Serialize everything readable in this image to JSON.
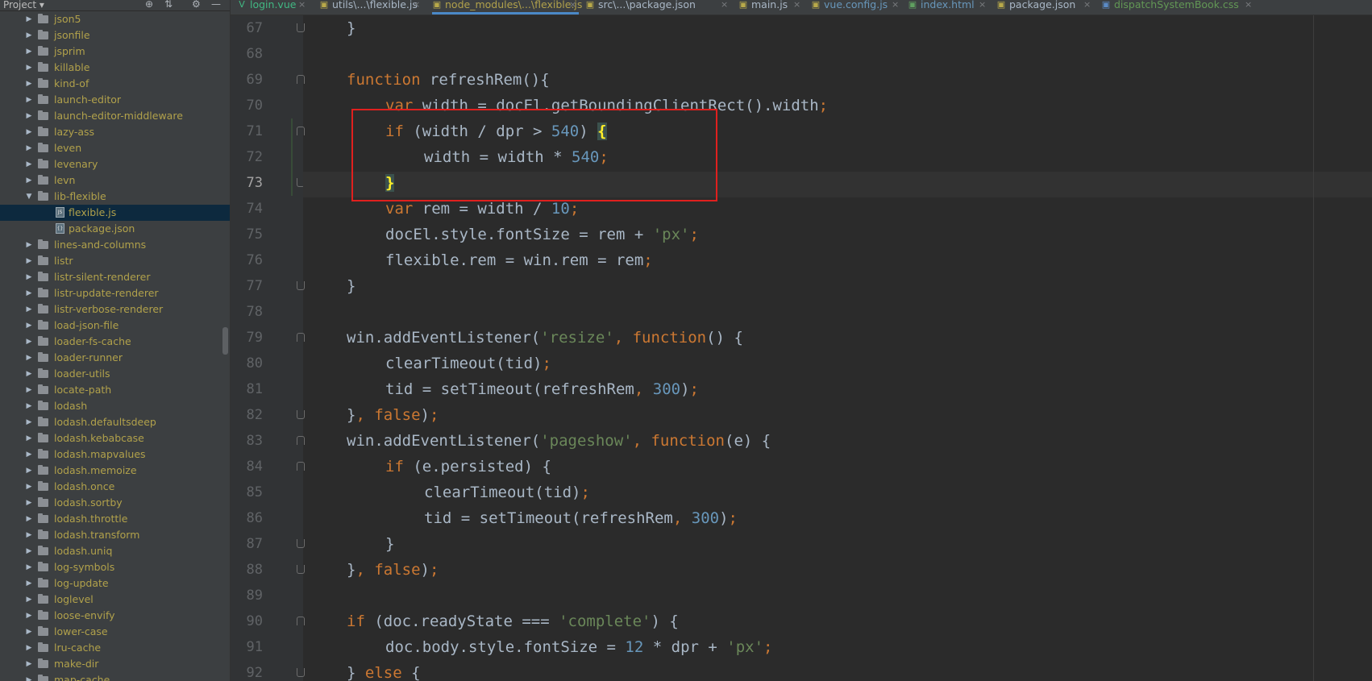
{
  "sidebar": {
    "title": "Project",
    "items": [
      {
        "label": "json5",
        "type": "folder",
        "expanded": false,
        "depth": 0
      },
      {
        "label": "jsonfile",
        "type": "folder",
        "expanded": false,
        "depth": 0
      },
      {
        "label": "jsprim",
        "type": "folder",
        "expanded": false,
        "depth": 0
      },
      {
        "label": "killable",
        "type": "folder",
        "expanded": false,
        "depth": 0
      },
      {
        "label": "kind-of",
        "type": "folder",
        "expanded": false,
        "depth": 0
      },
      {
        "label": "launch-editor",
        "type": "folder",
        "expanded": false,
        "depth": 0
      },
      {
        "label": "launch-editor-middleware",
        "type": "folder",
        "expanded": false,
        "depth": 0
      },
      {
        "label": "lazy-ass",
        "type": "folder",
        "expanded": false,
        "depth": 0
      },
      {
        "label": "leven",
        "type": "folder",
        "expanded": false,
        "depth": 0
      },
      {
        "label": "levenary",
        "type": "folder",
        "expanded": false,
        "depth": 0
      },
      {
        "label": "levn",
        "type": "folder",
        "expanded": false,
        "depth": 0
      },
      {
        "label": "lib-flexible",
        "type": "folder",
        "expanded": true,
        "depth": 0
      },
      {
        "label": "flexible.js",
        "type": "file",
        "icon": "js",
        "depth": 1,
        "selected": true
      },
      {
        "label": "package.json",
        "type": "file",
        "icon": "json",
        "depth": 1
      },
      {
        "label": "lines-and-columns",
        "type": "folder",
        "expanded": false,
        "depth": 0
      },
      {
        "label": "listr",
        "type": "folder",
        "expanded": false,
        "depth": 0
      },
      {
        "label": "listr-silent-renderer",
        "type": "folder",
        "expanded": false,
        "depth": 0
      },
      {
        "label": "listr-update-renderer",
        "type": "folder",
        "expanded": false,
        "depth": 0
      },
      {
        "label": "listr-verbose-renderer",
        "type": "folder",
        "expanded": false,
        "depth": 0
      },
      {
        "label": "load-json-file",
        "type": "folder",
        "expanded": false,
        "depth": 0
      },
      {
        "label": "loader-fs-cache",
        "type": "folder",
        "expanded": false,
        "depth": 0
      },
      {
        "label": "loader-runner",
        "type": "folder",
        "expanded": false,
        "depth": 0
      },
      {
        "label": "loader-utils",
        "type": "folder",
        "expanded": false,
        "depth": 0
      },
      {
        "label": "locate-path",
        "type": "folder",
        "expanded": false,
        "depth": 0
      },
      {
        "label": "lodash",
        "type": "folder",
        "expanded": false,
        "depth": 0
      },
      {
        "label": "lodash.defaultsdeep",
        "type": "folder",
        "expanded": false,
        "depth": 0
      },
      {
        "label": "lodash.kebabcase",
        "type": "folder",
        "expanded": false,
        "depth": 0
      },
      {
        "label": "lodash.mapvalues",
        "type": "folder",
        "expanded": false,
        "depth": 0
      },
      {
        "label": "lodash.memoize",
        "type": "folder",
        "expanded": false,
        "depth": 0
      },
      {
        "label": "lodash.once",
        "type": "folder",
        "expanded": false,
        "depth": 0
      },
      {
        "label": "lodash.sortby",
        "type": "folder",
        "expanded": false,
        "depth": 0
      },
      {
        "label": "lodash.throttle",
        "type": "folder",
        "expanded": false,
        "depth": 0
      },
      {
        "label": "lodash.transform",
        "type": "folder",
        "expanded": false,
        "depth": 0
      },
      {
        "label": "lodash.uniq",
        "type": "folder",
        "expanded": false,
        "depth": 0
      },
      {
        "label": "log-symbols",
        "type": "folder",
        "expanded": false,
        "depth": 0
      },
      {
        "label": "log-update",
        "type": "folder",
        "expanded": false,
        "depth": 0
      },
      {
        "label": "loglevel",
        "type": "folder",
        "expanded": false,
        "depth": 0
      },
      {
        "label": "loose-envify",
        "type": "folder",
        "expanded": false,
        "depth": 0
      },
      {
        "label": "lower-case",
        "type": "folder",
        "expanded": false,
        "depth": 0
      },
      {
        "label": "lru-cache",
        "type": "folder",
        "expanded": false,
        "depth": 0
      },
      {
        "label": "make-dir",
        "type": "folder",
        "expanded": false,
        "depth": 0
      },
      {
        "label": "map-cache",
        "type": "folder",
        "expanded": false,
        "depth": 0
      }
    ]
  },
  "tabs": [
    {
      "label": "login.vue",
      "icon": "vue-icon",
      "color": "#41b883"
    },
    {
      "label": "utils\\...\\flexible.js",
      "icon": "js-file-icon",
      "color": "#a9b7c6"
    },
    {
      "label": "node_modules\\...\\flexible.js",
      "icon": "js-file-icon",
      "color": "#b1a14b",
      "active": true
    },
    {
      "label": "src\\...\\package.json",
      "icon": "json-file-icon",
      "color": "#a9b7c6"
    },
    {
      "label": "main.js",
      "icon": "js-file-icon",
      "color": "#a9b7c6"
    },
    {
      "label": "vue.config.js",
      "icon": "js-file-icon",
      "color": "#6897bb"
    },
    {
      "label": "index.html",
      "icon": "html-file-icon",
      "color": "#6897bb"
    },
    {
      "label": "package.json",
      "icon": "json-file-icon",
      "color": "#a9b7c6"
    },
    {
      "label": "dispatchSystemBook.css",
      "icon": "css-file-icon",
      "color": "#629755"
    }
  ],
  "editor": {
    "current_line": 73,
    "lines": [
      {
        "n": "67",
        "indent": 1,
        "tokens": [
          [
            "p",
            "}"
          ]
        ]
      },
      {
        "n": "68",
        "indent": 0,
        "tokens": []
      },
      {
        "n": "69",
        "indent": 1,
        "tokens": [
          [
            "kw",
            "function "
          ],
          [
            "p",
            "refreshRem(){"
          ]
        ]
      },
      {
        "n": "70",
        "indent": 2,
        "tokens": [
          [
            "kw",
            "var "
          ],
          [
            "p",
            "width = docEl.getBoundingClientRect().width"
          ],
          [
            "kw",
            ";"
          ]
        ]
      },
      {
        "n": "71",
        "indent": 2,
        "tokens": [
          [
            "kw",
            "if "
          ],
          [
            "p",
            "(width / dpr > "
          ],
          [
            "num",
            "540"
          ],
          [
            "p",
            ") "
          ],
          [
            "bh",
            "{"
          ]
        ]
      },
      {
        "n": "72",
        "indent": 3,
        "tokens": [
          [
            "p",
            "width = width * "
          ],
          [
            "num",
            "540"
          ],
          [
            "kw",
            ";"
          ]
        ]
      },
      {
        "n": "73",
        "indent": 2,
        "tokens": [
          [
            "bh",
            "}"
          ]
        ]
      },
      {
        "n": "74",
        "indent": 2,
        "tokens": [
          [
            "kw",
            "var "
          ],
          [
            "p",
            "rem = width / "
          ],
          [
            "num",
            "10"
          ],
          [
            "kw",
            ";"
          ]
        ]
      },
      {
        "n": "75",
        "indent": 2,
        "tokens": [
          [
            "p",
            "docEl.style.fontSize = rem + "
          ],
          [
            "str",
            "'px'"
          ],
          [
            "kw",
            ";"
          ]
        ]
      },
      {
        "n": "76",
        "indent": 2,
        "tokens": [
          [
            "p",
            "flexible.rem = win.rem = rem"
          ],
          [
            "kw",
            ";"
          ]
        ]
      },
      {
        "n": "77",
        "indent": 1,
        "tokens": [
          [
            "p",
            "}"
          ]
        ]
      },
      {
        "n": "78",
        "indent": 0,
        "tokens": []
      },
      {
        "n": "79",
        "indent": 1,
        "tokens": [
          [
            "p",
            "win.addEventListener("
          ],
          [
            "str",
            "'resize'"
          ],
          [
            "kw",
            ", function"
          ],
          [
            "p",
            "() {"
          ]
        ]
      },
      {
        "n": "80",
        "indent": 2,
        "tokens": [
          [
            "p",
            "clearTimeout(tid)"
          ],
          [
            "kw",
            ";"
          ]
        ]
      },
      {
        "n": "81",
        "indent": 2,
        "tokens": [
          [
            "p",
            "tid = setTimeout(refreshRem"
          ],
          [
            "kw",
            ", "
          ],
          [
            "num",
            "300"
          ],
          [
            "p",
            ")"
          ],
          [
            "kw",
            ";"
          ]
        ]
      },
      {
        "n": "82",
        "indent": 1,
        "tokens": [
          [
            "p",
            "}"
          ],
          [
            "kw",
            ", false"
          ],
          [
            "p",
            ")"
          ],
          [
            "kw",
            ";"
          ]
        ]
      },
      {
        "n": "83",
        "indent": 1,
        "tokens": [
          [
            "p",
            "win.addEventListener("
          ],
          [
            "str",
            "'pageshow'"
          ],
          [
            "kw",
            ", function"
          ],
          [
            "p",
            "(e) {"
          ]
        ]
      },
      {
        "n": "84",
        "indent": 2,
        "tokens": [
          [
            "kw",
            "if "
          ],
          [
            "p",
            "(e.persisted) {"
          ]
        ]
      },
      {
        "n": "85",
        "indent": 3,
        "tokens": [
          [
            "p",
            "clearTimeout(tid)"
          ],
          [
            "kw",
            ";"
          ]
        ]
      },
      {
        "n": "86",
        "indent": 3,
        "tokens": [
          [
            "p",
            "tid = setTimeout(refreshRem"
          ],
          [
            "kw",
            ", "
          ],
          [
            "num",
            "300"
          ],
          [
            "p",
            ")"
          ],
          [
            "kw",
            ";"
          ]
        ]
      },
      {
        "n": "87",
        "indent": 2,
        "tokens": [
          [
            "p",
            "}"
          ]
        ]
      },
      {
        "n": "88",
        "indent": 1,
        "tokens": [
          [
            "p",
            "}"
          ],
          [
            "kw",
            ", false"
          ],
          [
            "p",
            ")"
          ],
          [
            "kw",
            ";"
          ]
        ]
      },
      {
        "n": "89",
        "indent": 0,
        "tokens": []
      },
      {
        "n": "90",
        "indent": 1,
        "tokens": [
          [
            "kw",
            "if "
          ],
          [
            "p",
            "(doc.readyState === "
          ],
          [
            "str",
            "'complete'"
          ],
          [
            "p",
            ") {"
          ]
        ]
      },
      {
        "n": "91",
        "indent": 2,
        "tokens": [
          [
            "p",
            "doc.body.style.fontSize = "
          ],
          [
            "num",
            "12"
          ],
          [
            "p",
            " * dpr + "
          ],
          [
            "str",
            "'px'"
          ],
          [
            "kw",
            ";"
          ]
        ]
      },
      {
        "n": "92",
        "indent": 1,
        "tokens": [
          [
            "p",
            "} "
          ],
          [
            "kw",
            "else "
          ],
          [
            "p",
            "{"
          ]
        ]
      }
    ]
  },
  "colors": {
    "keyword": "#cc7832",
    "string": "#6a8759",
    "number": "#6897bb",
    "plain": "#a9b7c6",
    "folder_text": "#b1a14b",
    "annotation_box": "#e0201e",
    "brace_match": "#ffef28"
  }
}
